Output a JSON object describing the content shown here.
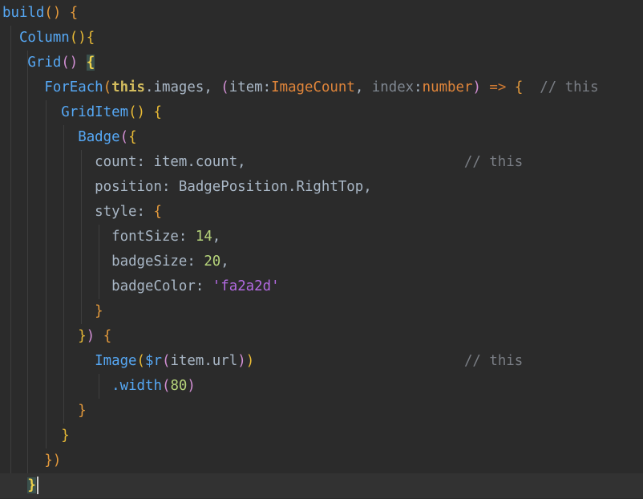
{
  "lines": [
    "build() {",
    "Column(){",
    "Grid() {",
    "ForEach(this.images, (item:ImageCount, index:number) => {",
    "GridItem() {",
    "Badge({",
    "count: item.count,",
    "position: BadgePosition.RightTop,",
    "style: {",
    "fontSize: 14,",
    "badgeSize: 20,",
    "badgeColor: 'fa2a2d'",
    "}",
    "}) {",
    "Image($r(item.url))",
    ".width(80)",
    "}",
    "}",
    "})",
    "}"
  ],
  "comments": {
    "foreach": "// this",
    "count": "// this",
    "image": "// this"
  },
  "tokens": {
    "build": "build",
    "column": "Column",
    "grid": "Grid",
    "foreach": "ForEach",
    "this": "this",
    "images": ".images, ",
    "item": "item",
    "image_count": "ImageCount",
    "index": "index",
    "number": "number",
    "arrow": "=>",
    "grid_item": "GridItem",
    "badge": "Badge",
    "count_key": "count",
    "count_val": "item.count,",
    "position_key": "position",
    "position_val": "BadgePosition.RightTop,",
    "style_key": "style",
    "font_size_key": "fontSize",
    "font_size_val": "14",
    "badge_size_key": "badgeSize",
    "badge_size_val": "20",
    "badge_color_key": "badgeColor",
    "badge_color_val": "'fa2a2d'",
    "image_fn": "Image",
    "r_fn": "$r",
    "url_arg": "item.url",
    "width_fn": ".width",
    "width_val": "80"
  },
  "theme": {
    "background": "#2b2b2b",
    "caret_line": "#323232",
    "function": "#56a8f5",
    "keyword_this": "#d4bd5e",
    "type": "#e0853a",
    "number": "#b5d37a",
    "string": "#b36ae2",
    "comment": "#7a7e85"
  }
}
